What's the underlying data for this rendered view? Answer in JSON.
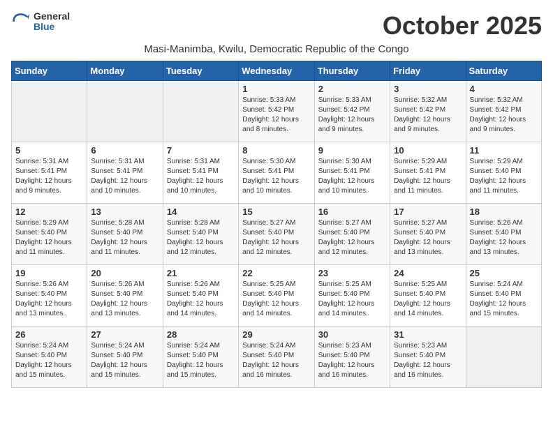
{
  "logo": {
    "general": "General",
    "blue": "Blue"
  },
  "month": "October 2025",
  "location": "Masi-Manimba, Kwilu, Democratic Republic of the Congo",
  "days_of_week": [
    "Sunday",
    "Monday",
    "Tuesday",
    "Wednesday",
    "Thursday",
    "Friday",
    "Saturday"
  ],
  "weeks": [
    [
      {
        "day": "",
        "info": ""
      },
      {
        "day": "",
        "info": ""
      },
      {
        "day": "",
        "info": ""
      },
      {
        "day": "1",
        "info": "Sunrise: 5:33 AM\nSunset: 5:42 PM\nDaylight: 12 hours and 8 minutes."
      },
      {
        "day": "2",
        "info": "Sunrise: 5:33 AM\nSunset: 5:42 PM\nDaylight: 12 hours and 9 minutes."
      },
      {
        "day": "3",
        "info": "Sunrise: 5:32 AM\nSunset: 5:42 PM\nDaylight: 12 hours and 9 minutes."
      },
      {
        "day": "4",
        "info": "Sunrise: 5:32 AM\nSunset: 5:42 PM\nDaylight: 12 hours and 9 minutes."
      }
    ],
    [
      {
        "day": "5",
        "info": "Sunrise: 5:31 AM\nSunset: 5:41 PM\nDaylight: 12 hours and 9 minutes."
      },
      {
        "day": "6",
        "info": "Sunrise: 5:31 AM\nSunset: 5:41 PM\nDaylight: 12 hours and 10 minutes."
      },
      {
        "day": "7",
        "info": "Sunrise: 5:31 AM\nSunset: 5:41 PM\nDaylight: 12 hours and 10 minutes."
      },
      {
        "day": "8",
        "info": "Sunrise: 5:30 AM\nSunset: 5:41 PM\nDaylight: 12 hours and 10 minutes."
      },
      {
        "day": "9",
        "info": "Sunrise: 5:30 AM\nSunset: 5:41 PM\nDaylight: 12 hours and 10 minutes."
      },
      {
        "day": "10",
        "info": "Sunrise: 5:29 AM\nSunset: 5:41 PM\nDaylight: 12 hours and 11 minutes."
      },
      {
        "day": "11",
        "info": "Sunrise: 5:29 AM\nSunset: 5:40 PM\nDaylight: 12 hours and 11 minutes."
      }
    ],
    [
      {
        "day": "12",
        "info": "Sunrise: 5:29 AM\nSunset: 5:40 PM\nDaylight: 12 hours and 11 minutes."
      },
      {
        "day": "13",
        "info": "Sunrise: 5:28 AM\nSunset: 5:40 PM\nDaylight: 12 hours and 11 minutes."
      },
      {
        "day": "14",
        "info": "Sunrise: 5:28 AM\nSunset: 5:40 PM\nDaylight: 12 hours and 12 minutes."
      },
      {
        "day": "15",
        "info": "Sunrise: 5:27 AM\nSunset: 5:40 PM\nDaylight: 12 hours and 12 minutes."
      },
      {
        "day": "16",
        "info": "Sunrise: 5:27 AM\nSunset: 5:40 PM\nDaylight: 12 hours and 12 minutes."
      },
      {
        "day": "17",
        "info": "Sunrise: 5:27 AM\nSunset: 5:40 PM\nDaylight: 12 hours and 13 minutes."
      },
      {
        "day": "18",
        "info": "Sunrise: 5:26 AM\nSunset: 5:40 PM\nDaylight: 12 hours and 13 minutes."
      }
    ],
    [
      {
        "day": "19",
        "info": "Sunrise: 5:26 AM\nSunset: 5:40 PM\nDaylight: 12 hours and 13 minutes."
      },
      {
        "day": "20",
        "info": "Sunrise: 5:26 AM\nSunset: 5:40 PM\nDaylight: 12 hours and 13 minutes."
      },
      {
        "day": "21",
        "info": "Sunrise: 5:26 AM\nSunset: 5:40 PM\nDaylight: 12 hours and 14 minutes."
      },
      {
        "day": "22",
        "info": "Sunrise: 5:25 AM\nSunset: 5:40 PM\nDaylight: 12 hours and 14 minutes."
      },
      {
        "day": "23",
        "info": "Sunrise: 5:25 AM\nSunset: 5:40 PM\nDaylight: 12 hours and 14 minutes."
      },
      {
        "day": "24",
        "info": "Sunrise: 5:25 AM\nSunset: 5:40 PM\nDaylight: 12 hours and 14 minutes."
      },
      {
        "day": "25",
        "info": "Sunrise: 5:24 AM\nSunset: 5:40 PM\nDaylight: 12 hours and 15 minutes."
      }
    ],
    [
      {
        "day": "26",
        "info": "Sunrise: 5:24 AM\nSunset: 5:40 PM\nDaylight: 12 hours and 15 minutes."
      },
      {
        "day": "27",
        "info": "Sunrise: 5:24 AM\nSunset: 5:40 PM\nDaylight: 12 hours and 15 minutes."
      },
      {
        "day": "28",
        "info": "Sunrise: 5:24 AM\nSunset: 5:40 PM\nDaylight: 12 hours and 15 minutes."
      },
      {
        "day": "29",
        "info": "Sunrise: 5:24 AM\nSunset: 5:40 PM\nDaylight: 12 hours and 16 minutes."
      },
      {
        "day": "30",
        "info": "Sunrise: 5:23 AM\nSunset: 5:40 PM\nDaylight: 12 hours and 16 minutes."
      },
      {
        "day": "31",
        "info": "Sunrise: 5:23 AM\nSunset: 5:40 PM\nDaylight: 12 hours and 16 minutes."
      },
      {
        "day": "",
        "info": ""
      }
    ]
  ]
}
